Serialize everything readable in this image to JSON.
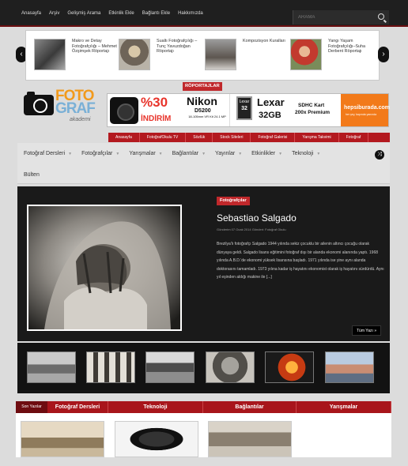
{
  "topnav": {
    "items": [
      "Anasayfa",
      "Arşiv",
      "Gelişmiş Arama",
      "Etkinlik Ekle",
      "Bağlantı Ekle",
      "Hakkımızda"
    ],
    "search_placeholder": "ARAMA"
  },
  "carousel": {
    "items": [
      {
        "title": "Makro ve Detay Fotoğrafçılığı – Mehmet Özşimşek Röportajı"
      },
      {
        "title": "Sualtı Fotoğrafçılığı – Tunç Yavuzdoğan Röportajı"
      },
      {
        "title": "Kompozisyon Kuralları"
      },
      {
        "title": "Yangı Yaşam Fotoğrafçılığı–Suha Derbent Röportajı"
      }
    ]
  },
  "logo": {
    "line1": "FOTO",
    "line2": "GRAF",
    "sub": "akademi"
  },
  "section_label": "RÖPORTAJLAR",
  "banner": {
    "nikon": {
      "percent": "%30",
      "discount": "İNDİRİM",
      "brand": "Nikon",
      "model": "D5200",
      "spec": "18-105mm VR Kit 24.1 MP"
    },
    "lexar": {
      "card_brand": "Lexar",
      "card_size": "32",
      "brand": "Lexar",
      "size": "32GB",
      "type1": "SDHC Kart",
      "type2": "200x Premium"
    },
    "shop": {
      "name": "hepsiburada.com",
      "tagline": "her şey, kapında yanında"
    }
  },
  "rednav": {
    "items": [
      "Anasayfa",
      "FotoğrafOkulu TV",
      "Sözlük",
      "Stock Siteleri",
      "Fotoğraf Galerisi",
      "Yarışma Takvimi",
      "Fotoğraf"
    ]
  },
  "mainnav": {
    "items": [
      "Fotoğraf Dersleri",
      "Fotoğrafçılar",
      "Yarışmalar",
      "Bağlantılar",
      "Yayınlar",
      "Etkinlikler",
      "Teknoloji"
    ],
    "second_row": "Bülten"
  },
  "featured": {
    "category": "Fotoğrafçılar",
    "title": "Sebastiao Salgado",
    "meta": "Gönderim 07 Ocak 2014 Gönderi: Fotoğraf Okulu",
    "body": "Brezilya'lı fotoğrafçı Salgado 1944 yılında sekiz çocuklu bir ailenin altıncı çocuğu olarak dünyaya geldi. Salgado lisans eğitimini fotoğraf dışı bir alanda ekonomi alanında yaptı. 1968 yılında A.B.D.'de ekonomi yüksek lisansına başladı. 1971 yılında ise yine aynı alanda doktorasını tamamladı. 1973 yılına kadar iş hayatını ekonomist olarak iş hayatını sürdürdü. Aynı yıl eşinden aldığı makine ile [...]",
    "more": "Tüm Yazı »"
  },
  "tabs": {
    "first": "Son Yazılar",
    "items": [
      "Fotoğraf Dersleri",
      "Teknoloji",
      "Bağlantılar",
      "Yarışmalar"
    ]
  },
  "colors": {
    "accent_red": "#c0282b",
    "dark": "#1a1a1a",
    "shop_orange": "#f27a1a"
  }
}
